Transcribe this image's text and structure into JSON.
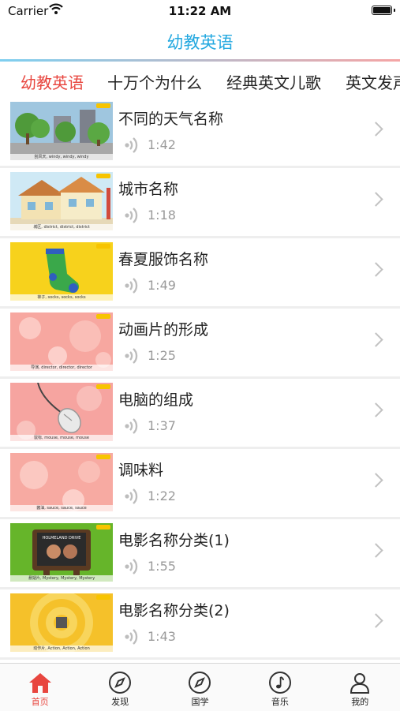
{
  "status": {
    "carrier": "Carrier",
    "time": "11:22 AM"
  },
  "nav": {
    "title": "幼教英语"
  },
  "tabs": [
    {
      "label": "幼教英语",
      "active": true
    },
    {
      "label": "十万个为什么",
      "active": false
    },
    {
      "label": "经典英文儿歌",
      "active": false
    },
    {
      "label": "英文发声",
      "active": false
    }
  ],
  "items": [
    {
      "title": "不同的天气名称",
      "duration": "1:42",
      "caption": "刮风天, windy, windy, windy",
      "thumb": "weather-street-scene"
    },
    {
      "title": "城市名称",
      "duration": "1:18",
      "caption": "城区, district, district, district",
      "thumb": "city-house-scene"
    },
    {
      "title": "春夏服饰名称",
      "duration": "1:49",
      "caption": "袜子, socks, socks, socks",
      "thumb": "socks-on-yellow"
    },
    {
      "title": "动画片的形成",
      "duration": "1:25",
      "caption": "导演, director, director, director",
      "thumb": "pink-bokeh"
    },
    {
      "title": "电脑的组成",
      "duration": "1:37",
      "caption": "鼠标, mouse, mouse, mouse",
      "thumb": "mouse-on-pink"
    },
    {
      "title": "调味料",
      "duration": "1:22",
      "caption": "酱油, sauce, sauce, sauce",
      "thumb": "pink-bokeh"
    },
    {
      "title": "电影名称分类(1)",
      "duration": "1:55",
      "caption": "悬疑片, Mystery, Mystery, Mystery",
      "thumb": "tv-on-green",
      "tv_text": "HOLMELAND DRIVE"
    },
    {
      "title": "电影名称分类(2)",
      "duration": "1:43",
      "caption": "动作片, Action, Action, Action",
      "thumb": "sunburst-yellow"
    }
  ],
  "tabbar": [
    {
      "label": "首页",
      "icon": "home-icon",
      "active": true
    },
    {
      "label": "发现",
      "icon": "compass-icon",
      "active": false
    },
    {
      "label": "国学",
      "icon": "compass-icon",
      "active": false
    },
    {
      "label": "音乐",
      "icon": "music-note-icon",
      "active": false
    },
    {
      "label": "我的",
      "icon": "person-icon",
      "active": false
    }
  ],
  "colors": {
    "accent": "#e8463f",
    "title_blue": "#25a9e0"
  }
}
